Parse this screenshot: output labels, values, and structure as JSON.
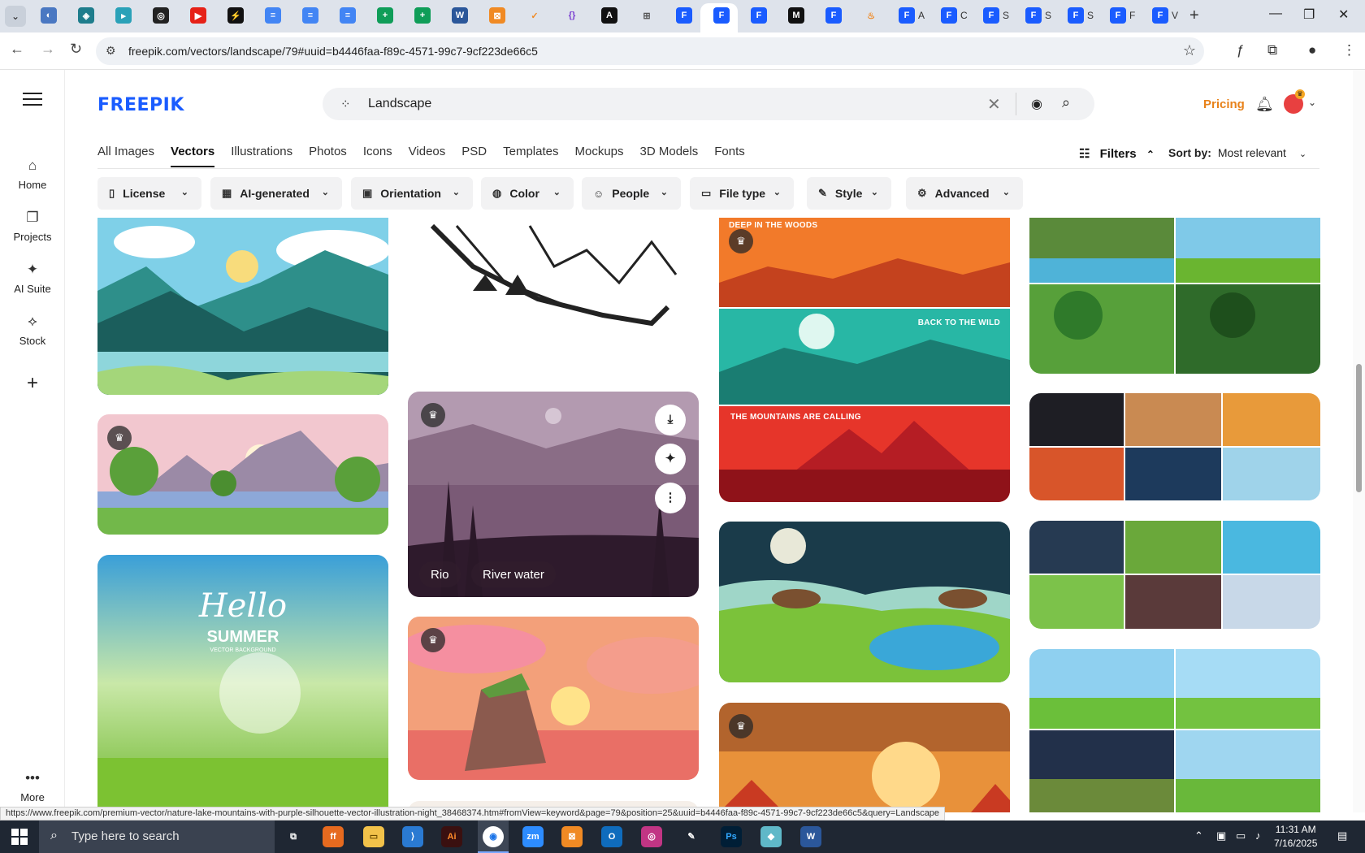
{
  "browser": {
    "tab_titles": [
      "A",
      "C",
      "S",
      "S",
      "S",
      "F",
      "V"
    ],
    "url": "freepik.com/vectors/landscape/79#uuid=b4446faa-f89c-4571-99c7-9cf223de66c5",
    "status_url": "https://www.freepik.com/premium-vector/nature-lake-mountains-with-purple-silhouette-vector-illustration-night_38468374.htm#fromView=keyword&page=79&position=25&uuid=b4446faa-f89c-4571-99c7-9cf223de66c5&query=Landscape"
  },
  "site": {
    "logo": "FREEPIK",
    "search_value": "Landscape",
    "pricing_label": "Pricing"
  },
  "rail": {
    "items": [
      {
        "label": "Home",
        "icon": "home-icon"
      },
      {
        "label": "Projects",
        "icon": "projects-icon"
      },
      {
        "label": "AI Suite",
        "icon": "sparkle-icon"
      },
      {
        "label": "Stock",
        "icon": "stock-icon"
      }
    ],
    "more_label": "More"
  },
  "categories": [
    "All Images",
    "Vectors",
    "Illustrations",
    "Photos",
    "Icons",
    "Videos",
    "PSD",
    "Templates",
    "Mockups",
    "3D Models",
    "Fonts"
  ],
  "active_category": "Vectors",
  "filters_label": "Filters",
  "sort": {
    "label": "Sort by:",
    "value": "Most relevant"
  },
  "chips": [
    "License",
    "AI-generated",
    "Orientation",
    "Color",
    "People",
    "File type",
    "Style",
    "Advanced"
  ],
  "cards": {
    "hovered_tags": [
      "Rio",
      "River water"
    ],
    "banner_1": "DEEP IN THE WOODS",
    "banner_2": "BACK TO THE WILD",
    "banner_3": "THE MOUNTAINS ARE CALLING",
    "hello_title": "Hello",
    "hello_sub": "SUMMER",
    "hello_caption": "VECTOR BACKGROUND"
  },
  "taskbar": {
    "search_placeholder": "Type here to search",
    "time": "11:31 AM",
    "date": "7/16/2025"
  },
  "colors": {
    "brand": "#1a5cff",
    "pricing": "#e8821a"
  }
}
